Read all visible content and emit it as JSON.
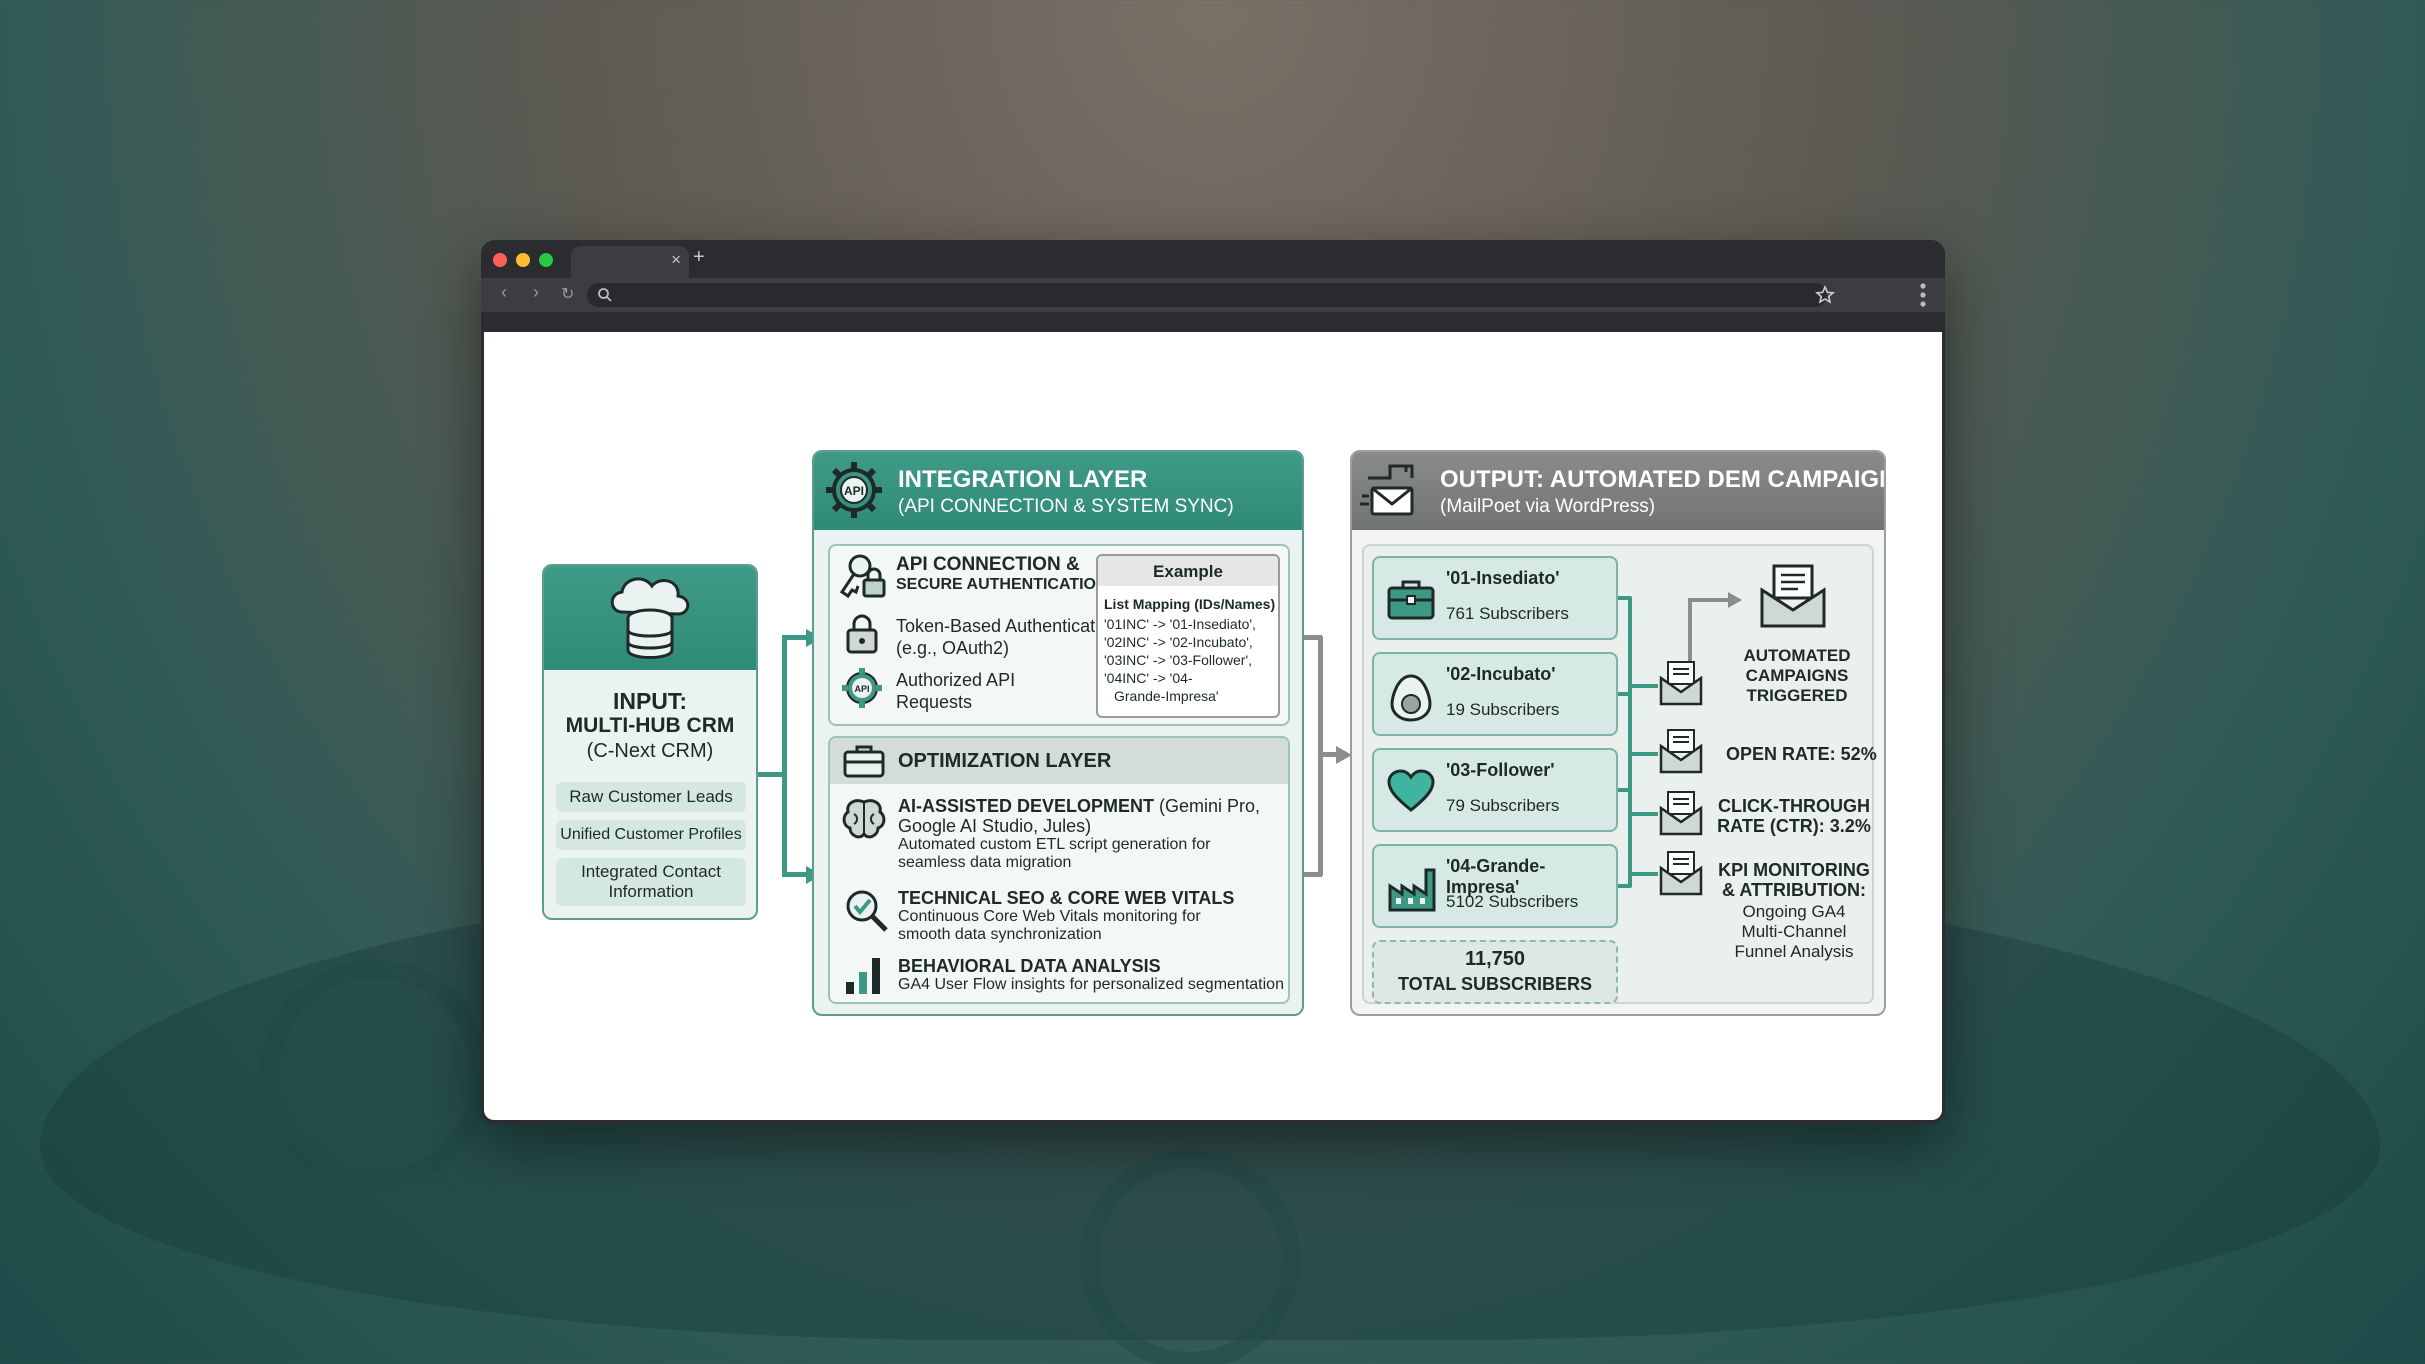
{
  "browser": {
    "tab_close": "×",
    "tab_new": "+",
    "nav_back": "‹",
    "nav_forward": "›",
    "nav_reload": "↻"
  },
  "input": {
    "title_line1": "INPUT:",
    "title_line2": "MULTI-HUB CRM",
    "title_line3": "(C-Next CRM)",
    "items": [
      "Raw Customer Leads",
      "Unified Customer Profiles",
      "Integrated Contact Information"
    ]
  },
  "integration": {
    "title": "INTEGRATION LAYER",
    "subtitle": "(API CONNECTION & SYSTEM SYNC)",
    "api": {
      "title_line1": "API CONNECTION &",
      "title_line2": "SECURE AUTHENTICATION",
      "token_line1": "Token-Based Authenticat",
      "token_line2": "(e.g., OAuth2)",
      "auth_line1": "Authorized API",
      "auth_line2": "Requests",
      "example_title": "Example",
      "mapping_title": "List Mapping (IDs/Names)",
      "mapping_lines": [
        "'01INC' -> '01-Insediato',",
        "'02INC' -> '02-Incubato',",
        "'03INC' -> '03-Follower',",
        "'04INC' -> '04-",
        "Grande-Impresa'"
      ]
    },
    "optimization": {
      "title": "OPTIMIZATION LAYER",
      "ai_title": "AI-ASSISTED DEVELOPMENT",
      "ai_title_rest": " (Gemini Pro,",
      "ai_line2": "Google AI Studio, Jules)",
      "ai_desc1": "Automated custom ETL script generation for",
      "ai_desc2": "seamless data migration",
      "seo_title": "TECHNICAL SEO & CORE WEB VITALS",
      "seo_desc1": "Continuous Core Web Vitals monitoring for",
      "seo_desc2": "smooth data synchronization",
      "beh_title": "BEHAVIORAL DATA ANALYSIS",
      "beh_desc": "GA4 User Flow insights for personalized segmentation"
    }
  },
  "output": {
    "title": "OUTPUT: AUTOMATED DEM CAMPAIGNS",
    "subtitle": "(MailPoet via WordPress)",
    "segments": [
      {
        "name": "'01-Insediato'",
        "count": "761 Subscribers"
      },
      {
        "name": "'02-Incubato'",
        "count": "19 Subscribers"
      },
      {
        "name": "'03-Follower'",
        "count": "79 Subscribers"
      },
      {
        "name": "'04-Grande-Impresa'",
        "count": "5102 Subscribers"
      }
    ],
    "total_number": "11,750",
    "total_label": "TOTAL SUBSCRIBERS",
    "triggered_lines": [
      "AUTOMATED",
      "CAMPAIGNS",
      "TRIGGERED"
    ],
    "open_rate": "OPEN RATE: 52%",
    "ctr_line1": "CLICK-THROUGH",
    "ctr_line2": "RATE (CTR): 3.2%",
    "kpi_line1": "KPI MONITORING",
    "kpi_line2": "& ATTRIBUTION:",
    "kpi_desc": [
      "Ongoing GA4",
      "Multi-Channel",
      "Funnel Analysis"
    ]
  },
  "colors": {
    "teal": "#2f8a78",
    "teal_light": "#d7e9e4",
    "grey_header": "#7a7c7c",
    "panel_bg": "#eaf3f1"
  },
  "icons": [
    "cloud-database-icon",
    "api-gear-icon",
    "key-lock-icon",
    "lock-icon",
    "api-badge-icon",
    "toolbox-icon",
    "brain-icon",
    "magnifier-check-icon",
    "bar-chart-icon",
    "mail-pipe-icon",
    "briefcase-icon",
    "egg-icon",
    "heart-icon",
    "factory-icon",
    "envelope-icon"
  ]
}
